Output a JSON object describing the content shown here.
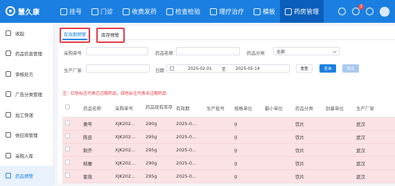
{
  "header": {
    "logo_text": "慧久康",
    "nav": [
      {
        "label": "挂号",
        "icon": "plus-icon"
      },
      {
        "label": "门诊",
        "icon": "clinic-icon"
      },
      {
        "label": "收费发药",
        "icon": "cashier-icon"
      },
      {
        "label": "检查检验",
        "icon": "lab-icon"
      },
      {
        "label": "理疗治疗",
        "icon": "therapy-icon"
      },
      {
        "label": "模板",
        "icon": "template-icon"
      },
      {
        "label": "药房管理",
        "icon": "pharmacy-icon",
        "active": true
      }
    ],
    "notification_count": "3"
  },
  "sidebar": {
    "items": [
      {
        "label": "收起",
        "icon": "collapse-icon"
      },
      {
        "label": "药品信息管理",
        "icon": "drug-info-icon"
      },
      {
        "label": "审核处方",
        "icon": "audit-icon"
      },
      {
        "label": "广告分类管理",
        "icon": "ad-category-icon"
      },
      {
        "label": "加工快递",
        "icon": "process-icon"
      },
      {
        "label": "供应商管理",
        "icon": "supplier-icon"
      },
      {
        "label": "采购入库",
        "icon": "purchase-icon"
      },
      {
        "label": "药品预警",
        "icon": "warning-icon",
        "active": true
      }
    ]
  },
  "tabs": [
    "有效期预警",
    "库存预警"
  ],
  "filters": {
    "purchase_no_label": "采购单号",
    "drug_name_label": "药品名称",
    "category_label": "药品分类",
    "category_value": "全部",
    "manufacturer_label": "生产厂家",
    "date_label": "日期",
    "date_start": "2025-02-01",
    "date_sep": "至",
    "date_end": "2025-05-14",
    "reset": "重置",
    "query": "查询",
    "export": "导出"
  },
  "note": "注：红色标注代表已过期药品，绿色标注代表未过期药品",
  "table": {
    "columns": [
      "药品名称",
      "采购单号",
      "药品现有库存",
      "有效期",
      "生产批号",
      "规格单位",
      "最小单位",
      "药品分类",
      "别量单位",
      "生产厂家"
    ],
    "rows": [
      [
        "黄芩",
        "XJK202...",
        "290g",
        "2025-0...",
        "",
        "g",
        "",
        "饮片",
        "",
        "武汉"
      ],
      [
        "陈皮",
        "XJK202...",
        "295g",
        "2025-0...",
        "",
        "g",
        "",
        "饮片",
        "",
        "武汉"
      ],
      [
        "荆芥",
        "XJK202...",
        "295g",
        "2025-0...",
        "",
        "g",
        "",
        "饮片",
        "",
        "武汉"
      ],
      [
        "桔梗",
        "XJK202...",
        "290g",
        "2025-0...",
        "",
        "g",
        "",
        "饮片",
        "",
        "武汉"
      ],
      [
        "紫苑",
        "XJK202...",
        "295g",
        "2025-0...",
        "",
        "g",
        "",
        "饮片",
        "",
        "武汉"
      ]
    ]
  },
  "colors": {
    "brand": "#1a7fe0",
    "expired_row": "#fbe2e4",
    "highlight": "#e2303a"
  }
}
